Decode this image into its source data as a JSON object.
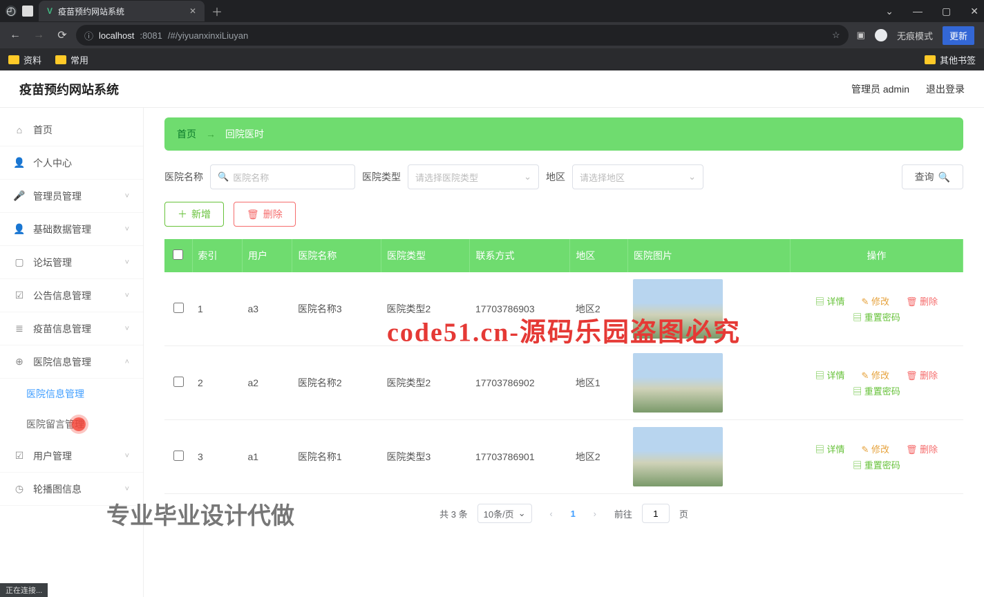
{
  "browser": {
    "tab_title": "疫苗预约网站系统",
    "url_prefix": "localhost",
    "url_port": ":8081",
    "url_path": "/#/yiyuanxinxiLiuyan",
    "incognito": "无痕模式",
    "update": "更新",
    "bookmarks": {
      "a": "资料",
      "b": "常用",
      "other": "其他书签"
    },
    "status": "正在连接..."
  },
  "header": {
    "title": "疫苗预约网站系统",
    "user": "管理员 admin",
    "logout": "退出登录"
  },
  "sidebar": {
    "items": [
      {
        "label": "首页",
        "icon": "home"
      },
      {
        "label": "个人中心",
        "icon": "user"
      },
      {
        "label": "管理员管理",
        "icon": "mic",
        "expandable": true
      },
      {
        "label": "基础数据管理",
        "icon": "user-plus",
        "expandable": true
      },
      {
        "label": "论坛管理",
        "icon": "clip",
        "expandable": true
      },
      {
        "label": "公告信息管理",
        "icon": "check",
        "expandable": true
      },
      {
        "label": "疫苗信息管理",
        "icon": "layers",
        "expandable": true
      },
      {
        "label": "医院信息管理",
        "icon": "globe",
        "expandable": true,
        "expanded": true,
        "children": [
          {
            "label": "医院信息管理",
            "active": true
          },
          {
            "label": "医院留言管理",
            "cursor": true
          }
        ]
      },
      {
        "label": "用户管理",
        "icon": "check",
        "expandable": true
      },
      {
        "label": "轮播图信息",
        "icon": "clock",
        "expandable": true
      }
    ]
  },
  "breadcrumb": {
    "home": "首页",
    "current": "回院医时"
  },
  "filters": {
    "name_label": "医院名称",
    "name_placeholder": "医院名称",
    "type_label": "医院类型",
    "type_placeholder": "请选择医院类型",
    "area_label": "地区",
    "area_placeholder": "请选择地区",
    "search": "查询"
  },
  "actions": {
    "add": "新增",
    "delete": "删除"
  },
  "table": {
    "headers": [
      "索引",
      "用户",
      "医院名称",
      "医院类型",
      "联系方式",
      "地区",
      "医院图片",
      "操作"
    ],
    "rows": [
      {
        "idx": "1",
        "user": "a3",
        "name": "医院名称3",
        "type": "医院类型2",
        "phone": "17703786903",
        "area": "地区2"
      },
      {
        "idx": "2",
        "user": "a2",
        "name": "医院名称2",
        "type": "医院类型2",
        "phone": "17703786902",
        "area": "地区1"
      },
      {
        "idx": "3",
        "user": "a1",
        "name": "医院名称1",
        "type": "医院类型3",
        "phone": "17703786901",
        "area": "地区2"
      }
    ],
    "ops": {
      "detail": "详情",
      "edit": "修改",
      "delete": "删除",
      "reset": "重置密码"
    }
  },
  "pager": {
    "total": "共 3 条",
    "perpage": "10条/页",
    "current": "1",
    "goto_pre": "前往",
    "goto_val": "1",
    "goto_suf": "页"
  },
  "watermark": "code51.cn-源码乐园盗图必究",
  "watermark2": "专业毕业设计代做"
}
